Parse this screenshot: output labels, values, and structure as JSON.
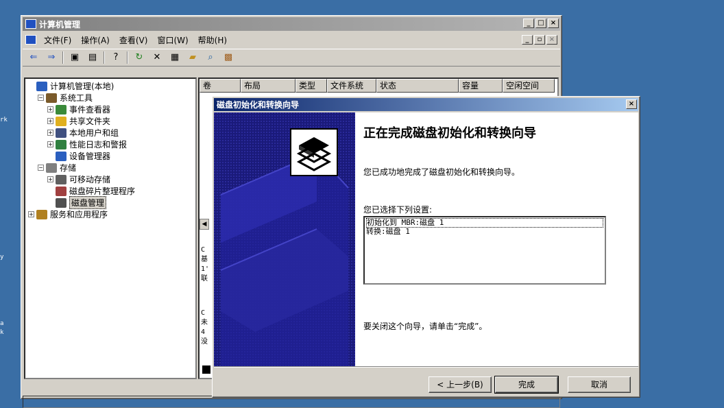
{
  "desktop": {
    "fragments": [
      "rk",
      "y",
      "a",
      "k"
    ]
  },
  "main_window": {
    "title": "计算机管理",
    "menu": [
      "文件(F)",
      "操作(A)",
      "查看(V)",
      "窗口(W)",
      "帮助(H)"
    ],
    "tree": [
      {
        "label": "计算机管理(本地)",
        "level": 0,
        "expander": "",
        "icon": "#2a5fbf"
      },
      {
        "label": "系统工具",
        "level": 1,
        "expander": "−",
        "icon": "#7a5a2a"
      },
      {
        "label": "事件查看器",
        "level": 2,
        "expander": "+",
        "icon": "#3a8a3a"
      },
      {
        "label": "共享文件夹",
        "level": 2,
        "expander": "+",
        "icon": "#e0b020"
      },
      {
        "label": "本地用户和组",
        "level": 2,
        "expander": "+",
        "icon": "#405080"
      },
      {
        "label": "性能日志和警报",
        "level": 2,
        "expander": "+",
        "icon": "#308040"
      },
      {
        "label": "设备管理器",
        "level": 2,
        "expander": "",
        "icon": "#2a5fbf"
      },
      {
        "label": "存储",
        "level": 1,
        "expander": "−",
        "icon": "#808080"
      },
      {
        "label": "可移动存储",
        "level": 2,
        "expander": "+",
        "icon": "#606060"
      },
      {
        "label": "磁盘碎片整理程序",
        "level": 2,
        "expander": "",
        "icon": "#a04040"
      },
      {
        "label": "磁盘管理",
        "level": 2,
        "expander": "",
        "icon": "#505050",
        "selected": true
      },
      {
        "label": "服务和应用程序",
        "level": 0,
        "expander": "+",
        "icon": "#b08020"
      }
    ],
    "columns": [
      {
        "label": "卷",
        "w": 60
      },
      {
        "label": "布局",
        "w": 80
      },
      {
        "label": "类型",
        "w": 46
      },
      {
        "label": "文件系统",
        "w": 72
      },
      {
        "label": "状态",
        "w": 120
      },
      {
        "label": "容量",
        "w": 64
      },
      {
        "label": "空闲空间",
        "w": 76
      }
    ],
    "fragments": [
      "C",
      "基",
      "1'",
      "联",
      "C",
      "未",
      "4",
      "没"
    ]
  },
  "dialog": {
    "title": "磁盘初始化和转换向导",
    "heading": "正在完成磁盘初始化和转换向导",
    "success_text": "您已成功地完成了磁盘初始化和转换向导。",
    "settings_label": "您已选择下列设置:",
    "settings": [
      "初始化到 MBR:磁盘 1",
      "转换:磁盘 1"
    ],
    "close_hint": "要关闭这个向导，请单击“完成”。",
    "buttons": {
      "back": "< 上一步(B)",
      "finish": "完成",
      "cancel": "取消"
    }
  }
}
